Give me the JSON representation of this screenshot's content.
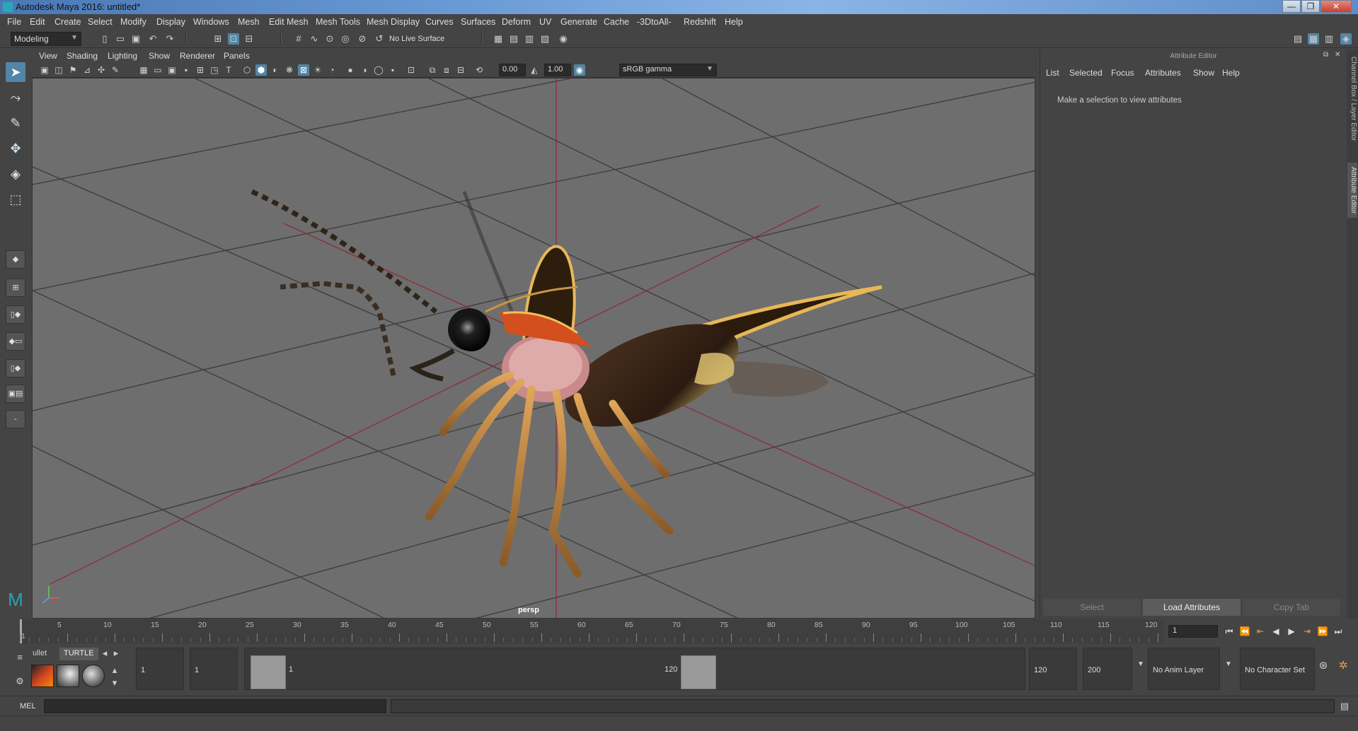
{
  "window": {
    "title": "Autodesk Maya 2016: untitled*",
    "minimize": "—",
    "restore": "❐",
    "close": "✕"
  },
  "menubar": [
    "File",
    "Edit",
    "Create",
    "Select",
    "Modify",
    "Display",
    "Windows",
    "Mesh",
    "Edit Mesh",
    "Mesh Tools",
    "Mesh Display",
    "Curves",
    "Surfaces",
    "Deform",
    "UV",
    "Generate",
    "Cache",
    "-3DtoAll-",
    "Redshift",
    "Help"
  ],
  "statusline": {
    "menuset": "Modeling",
    "live_surface": "No Live Surface"
  },
  "viewport_menu": [
    "View",
    "Shading",
    "Lighting",
    "Show",
    "Renderer",
    "Panels"
  ],
  "viewport_toolbar": {
    "exposure": "0.00",
    "gamma": "1.00",
    "color_space": "sRGB gamma"
  },
  "viewport": {
    "camera": "persp"
  },
  "attribute_editor": {
    "title": "Attribute Editor",
    "menu": [
      "List",
      "Selected",
      "Focus",
      "Attributes",
      "Show",
      "Help"
    ],
    "message": "Make a selection to view attributes",
    "buttons": {
      "select": "Select",
      "load": "Load Attributes",
      "copy": "Copy Tab"
    }
  },
  "side_tabs": {
    "channel_box": "Channel Box / Layer Editor",
    "attribute_editor": "Attribute Editor"
  },
  "timeslider": {
    "labels": [
      "1",
      "5",
      "10",
      "15",
      "20",
      "25",
      "30",
      "35",
      "40",
      "45",
      "50",
      "55",
      "60",
      "65",
      "70",
      "75",
      "80",
      "85",
      "90",
      "95",
      "100",
      "105",
      "110",
      "115",
      "120"
    ],
    "current_frame": "1"
  },
  "shelf": {
    "tabs": [
      "ullet",
      "TURTLE"
    ]
  },
  "range": {
    "start": "1",
    "playback_start": "1",
    "handle_start": "1",
    "handle_end": "120",
    "playback_end": "120",
    "end": "200",
    "anim_layer": "No Anim Layer",
    "character_set": "No Character Set"
  },
  "cmdline": {
    "label": "MEL"
  }
}
